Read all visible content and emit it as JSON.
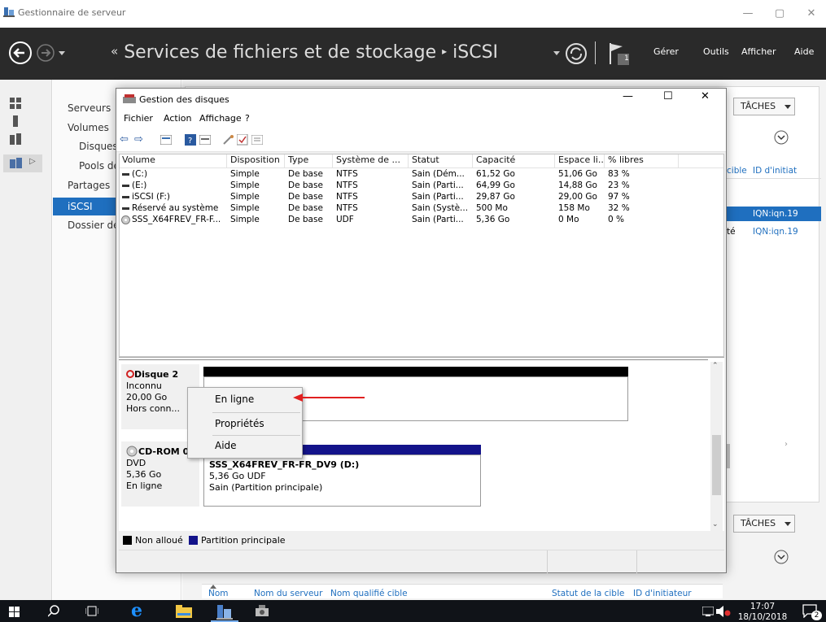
{
  "window": {
    "title": "Gestionnaire de serveur"
  },
  "header": {
    "breadcrumb_root": "Services de fichiers et de stockage",
    "breadcrumb_leaf": "iSCSI",
    "notif_count": "1"
  },
  "header_menu": [
    "Gérer",
    "Outils",
    "Afficher",
    "Aide"
  ],
  "nav": [
    "Serveurs",
    "Volumes",
    "Disques",
    "Pools de",
    "Partages",
    "iSCSI",
    "Dossier de"
  ],
  "main": {
    "taches": "TÂCHES",
    "right_cols": {
      "c1": "cible",
      "c2": "ID d'initiat"
    },
    "right_rows": [
      {
        "c1": "",
        "c2": "IQN:iqn.19"
      },
      {
        "c1": "té",
        "c2": "IQN:iqn.19"
      }
    ],
    "bottom_cols": [
      "Nom",
      "Nom du serveur",
      "Nom qualifié cible",
      "Statut de la cible",
      "ID d'initiateur"
    ]
  },
  "dm": {
    "title": "Gestion des disques",
    "menu": [
      "Fichier",
      "Action",
      "Affichage",
      "?"
    ],
    "columns": [
      "Volume",
      "Disposition",
      "Type",
      "Système de ...",
      "Statut",
      "Capacité",
      "Espace li...",
      "% libres"
    ],
    "rows": [
      [
        "(C:)",
        "Simple",
        "De base",
        "NTFS",
        "Sain (Dém...",
        "61,52 Go",
        "51,06 Go",
        "83 %"
      ],
      [
        "(E:)",
        "Simple",
        "De base",
        "NTFS",
        "Sain (Parti...",
        "64,99 Go",
        "14,88 Go",
        "23 %"
      ],
      [
        "iSCSI (F:)",
        "Simple",
        "De base",
        "NTFS",
        "Sain (Parti...",
        "29,87 Go",
        "29,00 Go",
        "97 %"
      ],
      [
        "Réservé au système",
        "Simple",
        "De base",
        "NTFS",
        "Sain (Systè...",
        "500 Mo",
        "158 Mo",
        "32 %"
      ],
      [
        "SSS_X64FREV_FR-F...",
        "Simple",
        "De base",
        "UDF",
        "Sain (Parti...",
        "5,36 Go",
        "0 Mo",
        "0 %"
      ]
    ],
    "disk2": {
      "name": "Disque 2",
      "type": "Inconnu",
      "size": "20,00 Go",
      "status": "Hors conn..."
    },
    "cdrom": {
      "name": "CD-ROM 0",
      "type": "DVD",
      "size": "5,36 Go",
      "status": "En ligne"
    },
    "cd_part": {
      "name": "SSS_X64FREV_FR-FR_DV9 (D:)",
      "fs": "5,36 Go UDF",
      "status": "Sain (Partition principale)"
    },
    "legend": {
      "unalloc": "Non alloué",
      "primary": "Partition principale"
    }
  },
  "context_menu": [
    "En ligne",
    "Propriétés",
    "Aide"
  ],
  "taskbar": {
    "time": "17:07",
    "date": "18/10/2018",
    "notif_count": "2"
  },
  "colors": {
    "header_bg": "#2a2a2a",
    "nav_selected": "#1f6fbf",
    "partition_primary": "#13138a",
    "unallocated": "#000000",
    "arrow": "#e02020"
  }
}
